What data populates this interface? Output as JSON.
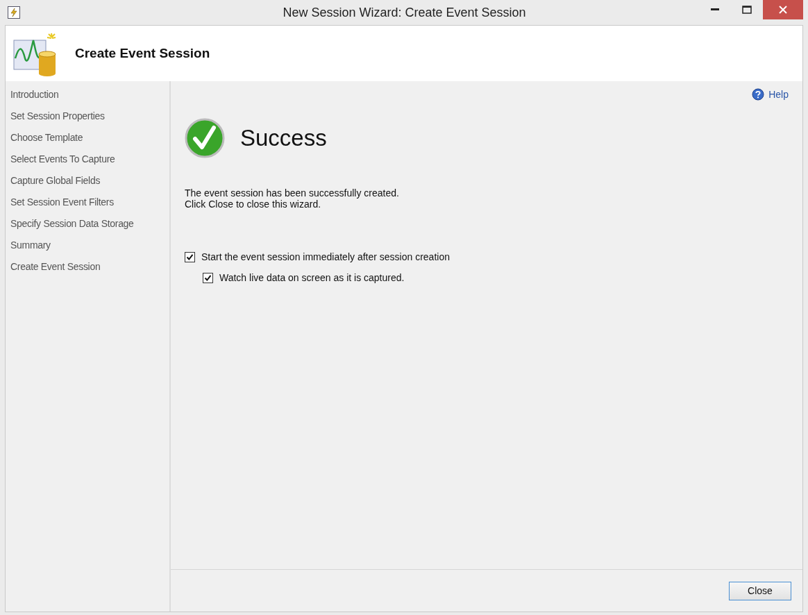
{
  "window": {
    "title": "New Session Wizard: Create Event Session"
  },
  "header": {
    "title": "Create Event Session"
  },
  "steps": [
    "Introduction",
    "Set Session Properties",
    "Choose Template",
    "Select Events To Capture",
    "Capture Global Fields",
    "Set Session Event Filters",
    "Specify Session Data Storage",
    "Summary",
    "Create Event Session"
  ],
  "help": {
    "label": "Help"
  },
  "status": {
    "heading": "Success",
    "message_lines": [
      "The event session has been successfully created.",
      "Click Close to close this wizard."
    ]
  },
  "options": [
    {
      "label": "Start the event session immediately after session creation",
      "checked": true,
      "children": [
        {
          "label": "Watch live data on screen as it is captured.",
          "checked": true
        }
      ]
    }
  ],
  "buttons": [
    "Close"
  ]
}
